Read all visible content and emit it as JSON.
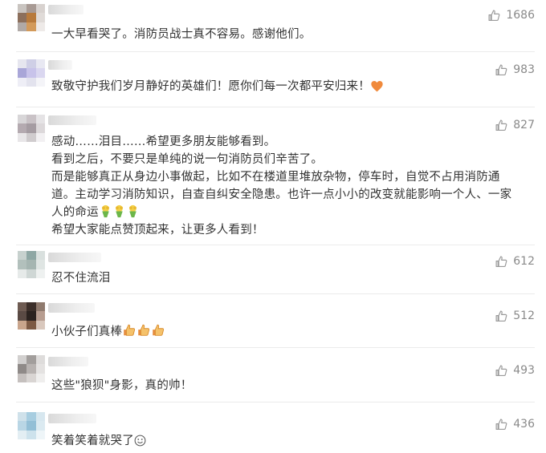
{
  "comments": [
    {
      "text": "一大早看哭了。消防员战士真不容易。感谢他们。",
      "likes": "1686",
      "icon": "thumbs-up-icon"
    },
    {
      "text": "致敬守护我们岁月静好的英雄们！愿你们每一次都平安归来！",
      "emoji": "orange-heart-emoji",
      "likes": "983",
      "icon": "thumbs-up-icon"
    },
    {
      "text": "感动……泪目……希望更多朋友能够看到。\n看到之后，不要只是单纯的说一句消防员们辛苦了。\n而是能够真正从身边小事做起，比如不在楼道里堆放杂物，停车时，自觉不占用消防通道。主动学习消防知识，自查自纠安全隐患。也许一点小小的改变就能影响一个人、一家人的命运",
      "emoji": "bouquet-emoji x3",
      "text2": "希望大家能点赞顶起来，让更多人看到！",
      "likes": "827",
      "icon": "thumbs-up-icon"
    },
    {
      "text": "忍不住流泪",
      "likes": "612",
      "icon": "thumbs-up-icon"
    },
    {
      "text": "小伙子们真棒",
      "emoji": "thumbs-up-emoji x3",
      "likes": "512",
      "icon": "thumbs-up-icon"
    },
    {
      "text": "这些\"狼狈\"身影，真的帅！",
      "likes": "493",
      "icon": "thumbs-up-icon"
    },
    {
      "text": "笑着笑着就哭了",
      "emoji": "smiley-emoji",
      "likes": "436",
      "icon": "thumbs-up-icon"
    }
  ],
  "colors": {
    "text": "#333333",
    "likes": "#8a8a8a",
    "divider": "#ebebeb",
    "heart": "#f08a3c"
  }
}
